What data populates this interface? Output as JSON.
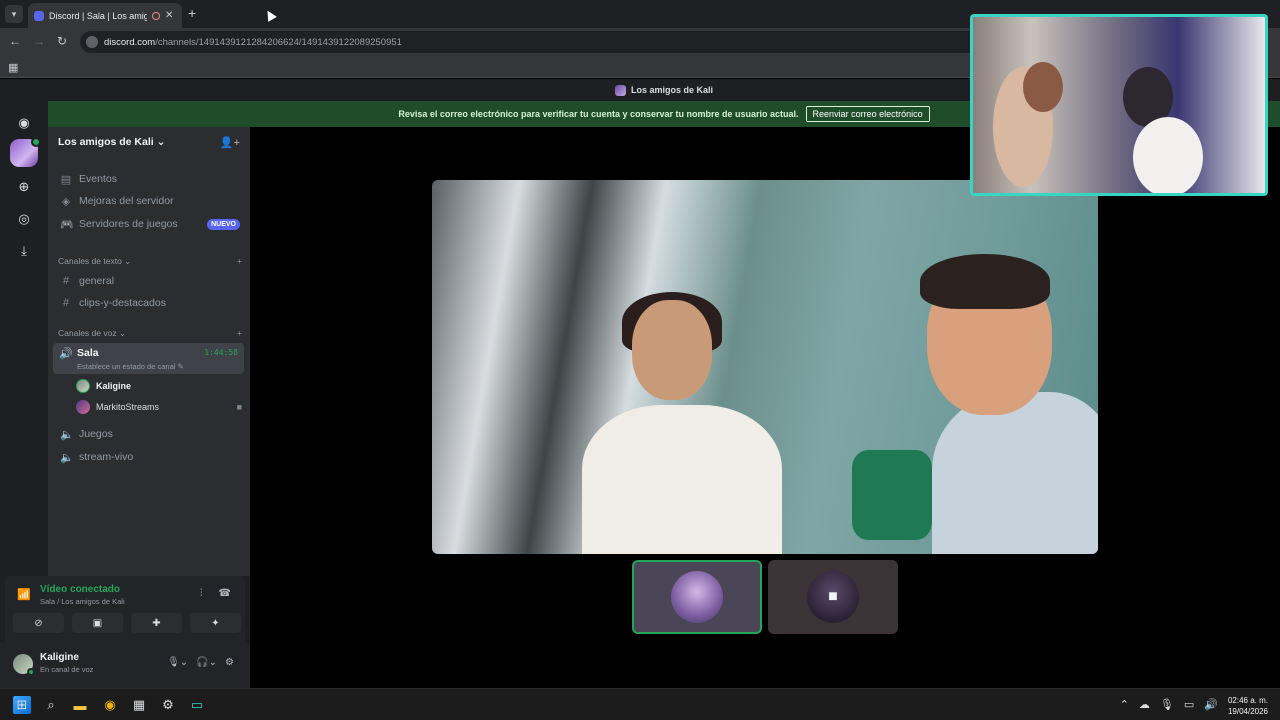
{
  "browser": {
    "tab_title": "Discord | Sala | Los amigos de Kali",
    "tab_close": "✕",
    "new_tab": "+",
    "url_domain": "discord.com",
    "url_path": "/channels/1491439121284206624/1491439122089250951"
  },
  "discord": {
    "server_name": "Los amigos de Kali",
    "notice_text": "Revisa el correo electrónico para verificar tu cuenta y conservar tu nombre de usuario actual.",
    "notice_button": "Reenviar correo electrónico",
    "sidebar": {
      "header": "Los amigos de Kali",
      "items": [
        {
          "label": "Eventos",
          "icon": "calendar-icon"
        },
        {
          "label": "Mejoras del servidor",
          "icon": "boost-icon"
        },
        {
          "label": "Servidores de juegos",
          "icon": "gamepad-icon",
          "badge": "NUEVO"
        }
      ],
      "text_category": "Canales de texto",
      "text_channels": [
        "general",
        "clips-y-destacados"
      ],
      "voice_category": "Canales de voz",
      "active_voice": {
        "name": "Sala",
        "time": "1:44:58",
        "status": "Establece un estado de canal"
      },
      "members": [
        "Kaligine",
        "MarkitoStreams"
      ],
      "other_voice": [
        "Juegos",
        "stream-vivo"
      ]
    },
    "voice_panel": {
      "title": "Vídeo conectado",
      "subtitle": "Sala / Los amigos de Kali"
    },
    "user": {
      "name": "Kaligine",
      "status": "En canal de voz"
    }
  },
  "taskbar": {
    "time": "02:46 a. m.",
    "date": "19/04/2026"
  },
  "colors": {
    "green": "#23a55a",
    "blurple": "#5865f2",
    "notice_bg": "#1f4d2b",
    "pip_border": "#36d6c2"
  }
}
